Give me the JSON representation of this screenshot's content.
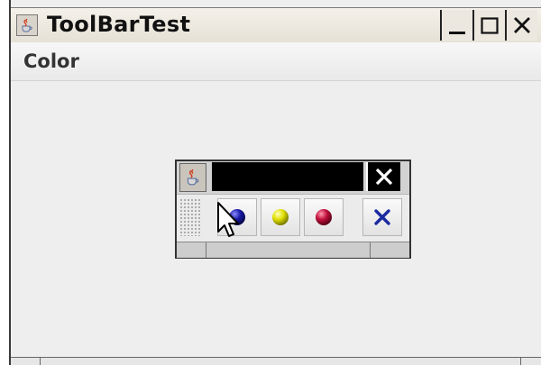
{
  "window": {
    "title": "ToolBarTest",
    "title_icon": "java-cup-icon",
    "controls": [
      "minimize-icon",
      "maximize-icon",
      "close-icon"
    ]
  },
  "menubar": {
    "items": [
      "Color"
    ]
  },
  "floating_toolbar": {
    "title": "",
    "icon": "java-cup-icon",
    "close_icon": "close-icon",
    "buttons": [
      {
        "name": "blue-ball-button",
        "icon": "blue-ball-icon",
        "color": "#1a1aa8"
      },
      {
        "name": "yellow-ball-button",
        "icon": "yellow-ball-icon",
        "color": "#e0e000"
      },
      {
        "name": "red-ball-button",
        "icon": "red-ball-icon",
        "color": "#c0103a"
      },
      {
        "name": "exit-button",
        "icon": "blue-x-icon",
        "color": "#1a2aa0"
      }
    ]
  },
  "colors": {
    "background": "#eeeeee",
    "titlebar": "#ece8e0",
    "toolbar_title": "#000000"
  }
}
